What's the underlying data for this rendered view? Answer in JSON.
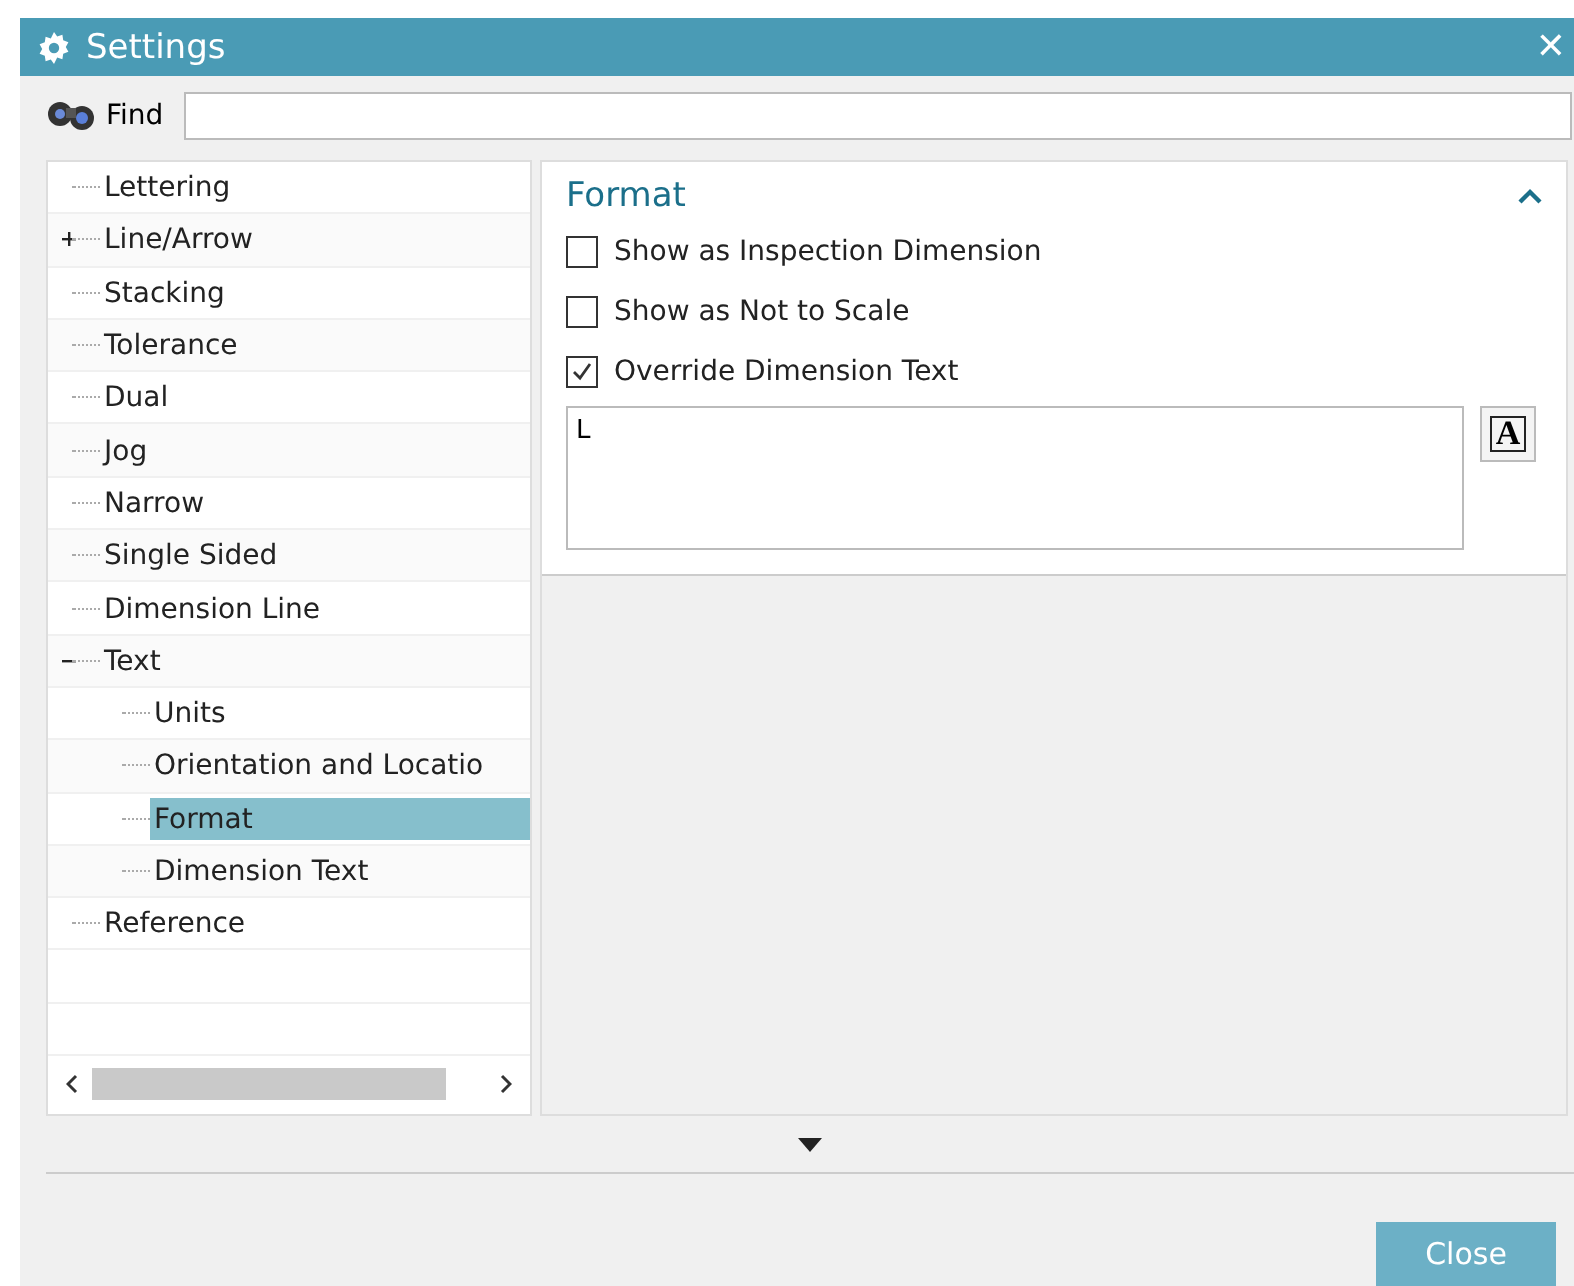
{
  "window": {
    "title": "Settings",
    "close": "✕"
  },
  "find": {
    "label": "Find"
  },
  "tree": {
    "items": [
      {
        "label": "Lettering",
        "selected": false
      },
      {
        "label": "Line/Arrow",
        "expanded": false,
        "selected": false
      },
      {
        "label": "Stacking",
        "selected": false
      },
      {
        "label": "Tolerance",
        "selected": false
      },
      {
        "label": "Dual",
        "selected": false
      },
      {
        "label": "Jog",
        "selected": false
      },
      {
        "label": "Narrow",
        "selected": false
      },
      {
        "label": "Single Sided",
        "selected": false
      },
      {
        "label": "Dimension Line",
        "selected": false
      },
      {
        "label": "Text",
        "expanded": true,
        "selected": false,
        "children": [
          {
            "label": "Units",
            "selected": false
          },
          {
            "label": "Orientation and Locatio",
            "selected": false
          },
          {
            "label": "Format",
            "selected": true
          },
          {
            "label": "Dimension Text",
            "selected": false
          }
        ]
      },
      {
        "label": "Reference",
        "selected": false
      }
    ]
  },
  "section": {
    "title": "Format",
    "expanded": true,
    "options": [
      {
        "label": "Show as Inspection Dimension",
        "checked": false
      },
      {
        "label": "Show as Not to Scale",
        "checked": false
      },
      {
        "label": "Override Dimension Text",
        "checked": true
      }
    ],
    "text_value": "L",
    "font_button": "A"
  },
  "buttons": [
    {
      "label": "Close"
    }
  ]
}
